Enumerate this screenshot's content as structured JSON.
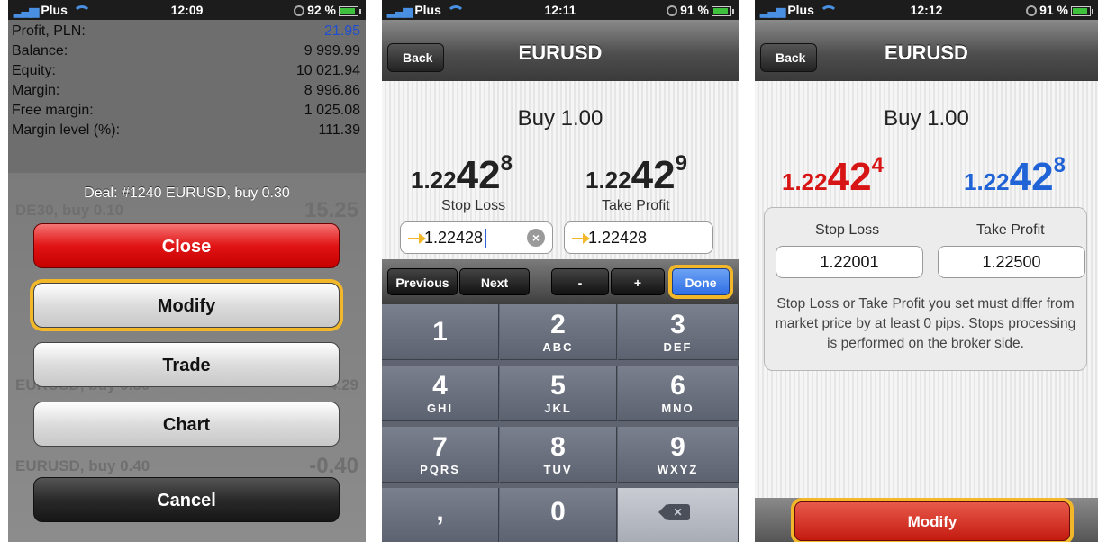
{
  "panel1": {
    "status": {
      "carrier": "Plus",
      "time": "12:09",
      "battery": "92 %"
    },
    "account": [
      {
        "label": "Profit, PLN:",
        "value": "21.95"
      },
      {
        "label": "Balance:",
        "value": "9 999.99"
      },
      {
        "label": "Equity:",
        "value": "10 021.94"
      },
      {
        "label": "Margin:",
        "value": "8 996.86"
      },
      {
        "label": "Free margin:",
        "value": "1 025.08"
      },
      {
        "label": "Margin level (%):",
        "value": "111.39"
      }
    ],
    "background_rows": [
      {
        "name": "DE30, buy 0.10",
        "value": "15.25"
      },
      {
        "name": "EURUSD, buy 0.30",
        "value": "4.29"
      },
      {
        "name": "EURUSD, buy 0.40",
        "value": "-0.40"
      }
    ],
    "sheet": {
      "title": "Deal: #1240 EURUSD, buy 0.30",
      "close": "Close",
      "modify": "Modify",
      "trade": "Trade",
      "chart": "Chart",
      "cancel": "Cancel"
    }
  },
  "panel2": {
    "status": {
      "carrier": "Plus",
      "time": "12:11",
      "battery": "91 %"
    },
    "nav": {
      "back": "Back",
      "title": "EURUSD"
    },
    "order": "Buy 1.00",
    "bid": {
      "prefix": "1.22",
      "big": "42",
      "sup": "8"
    },
    "ask": {
      "prefix": "1.22",
      "big": "42",
      "sup": "9"
    },
    "stop_loss_label": "Stop Loss",
    "take_profit_label": "Take Profit",
    "stop_loss_value": "1.22428",
    "take_profit_value": "1.22428",
    "toolbar": {
      "previous": "Previous",
      "next": "Next",
      "minus": "-",
      "plus": "+",
      "done": "Done"
    },
    "keys": [
      {
        "num": "1",
        "letters": ""
      },
      {
        "num": "2",
        "letters": "ABC"
      },
      {
        "num": "3",
        "letters": "DEF"
      },
      {
        "num": "4",
        "letters": "GHI"
      },
      {
        "num": "5",
        "letters": "JKL"
      },
      {
        "num": "6",
        "letters": "MNO"
      },
      {
        "num": "7",
        "letters": "PQRS"
      },
      {
        "num": "8",
        "letters": "TUV"
      },
      {
        "num": "9",
        "letters": "WXYZ"
      },
      {
        "num": ",",
        "letters": ""
      },
      {
        "num": "0",
        "letters": ""
      }
    ]
  },
  "panel3": {
    "status": {
      "carrier": "Plus",
      "time": "12:12",
      "battery": "91 %"
    },
    "nav": {
      "back": "Back",
      "title": "EURUSD"
    },
    "order": "Buy 1.00",
    "bid": {
      "prefix": "1.22",
      "big": "42",
      "sup": "4"
    },
    "ask": {
      "prefix": "1.22",
      "big": "42",
      "sup": "8"
    },
    "stop_loss_label": "Stop Loss",
    "take_profit_label": "Take Profit",
    "stop_loss_value": "1.22001",
    "take_profit_value": "1.22500",
    "note": "Stop Loss or Take Profit you set must differ from market price by at least 0 pips. Stops processing is performed on the broker side.",
    "modify": "Modify"
  },
  "colors": {
    "highlight": "#f3b72a",
    "bid_red": "#d81515",
    "ask_blue": "#1f63d6",
    "profit_blue": "#1f4fd1",
    "close_red": "#e11414"
  }
}
